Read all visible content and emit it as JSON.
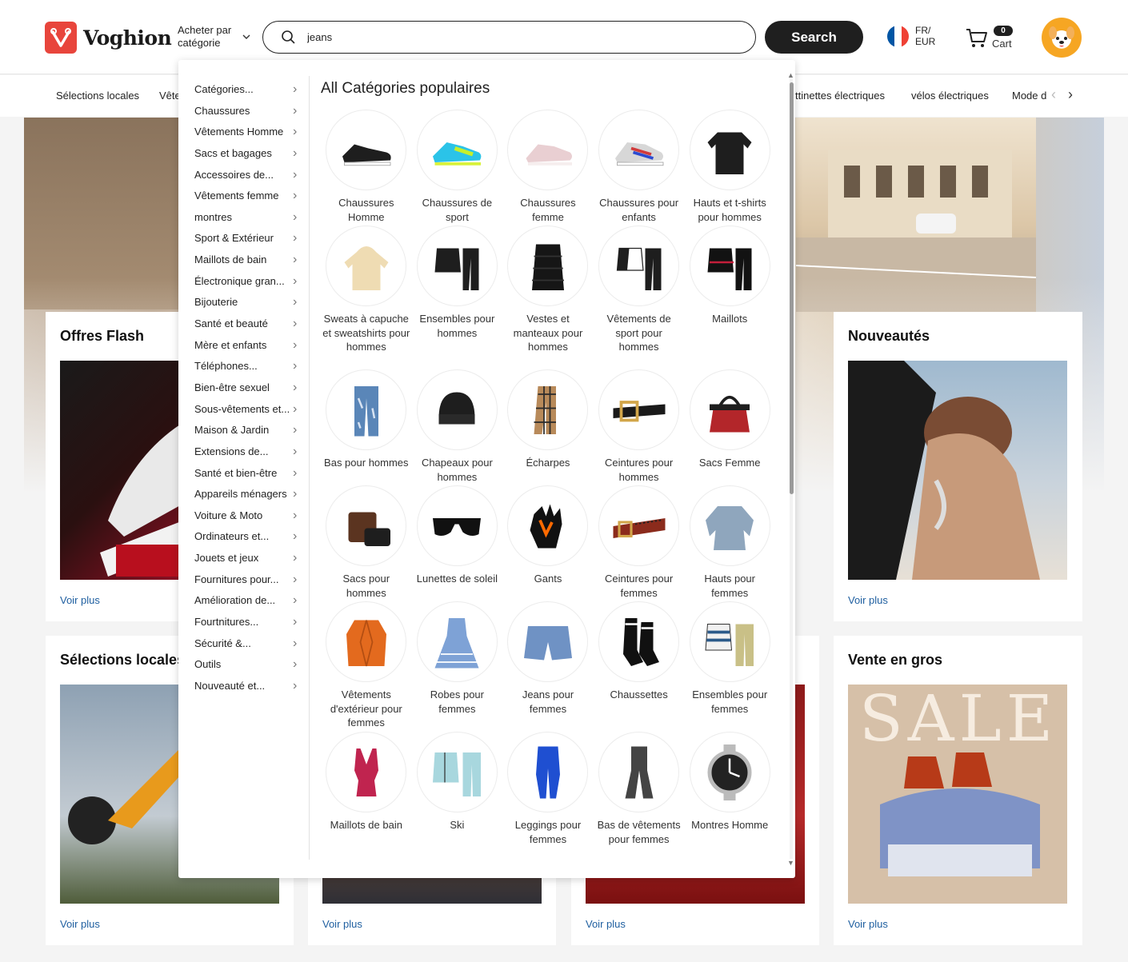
{
  "header": {
    "logo_text": "Voghion",
    "category_button": "Acheter par catégorie",
    "search": {
      "value": "jeans",
      "button": "Search"
    },
    "locale": {
      "lang": "FR/",
      "currency": "EUR",
      "flag_colors": [
        "#0055a4",
        "#ffffff",
        "#ef4135"
      ]
    },
    "cart": {
      "count": "0",
      "label": "Cart"
    },
    "accent_color": "#e8453c"
  },
  "subnav": {
    "left_items": [
      "Sélections locales",
      "Vête"
    ],
    "right_items": [
      "ttinettes électriques",
      "vélos électriques",
      "Mode d"
    ]
  },
  "cards": {
    "offres_flash": {
      "title": "Offres Flash",
      "more": "Voir plus"
    },
    "nouveautes": {
      "title": "Nouveautés",
      "more": "Voir plus"
    },
    "selections_locales": {
      "title": "Sélections locales",
      "more": "Voir plus"
    },
    "col2": {
      "more": "Voir plus"
    },
    "col3": {
      "more": "Voir plus"
    },
    "vente_en_gros": {
      "title": "Vente en gros",
      "more": "Voir plus",
      "image_text": "SALE"
    }
  },
  "dropdown": {
    "categories": [
      "Catégories...",
      "Chaussures",
      "Vêtements Homme",
      "Sacs et bagages",
      "Accessoires de...",
      "Vêtements femme",
      "montres",
      "Sport & Extérieur",
      "Maillots de bain",
      "Électronique gran...",
      "Bijouterie",
      "Santé et beauté",
      "Mère et enfants",
      "Téléphones...",
      "Bien-être sexuel",
      "Sous-vêtements et...",
      "Maison & Jardin",
      "Extensions de...",
      "Santé et bien-être",
      "Appareils ménagers",
      "Voiture & Moto",
      "Ordinateurs et...",
      "Jouets et jeux",
      "Fournitures pour...",
      "Amélioration de...",
      "Fourtnitures...",
      "Sécurité &...",
      "Outils",
      "Nouveauté et..."
    ],
    "popular_title": "All Catégories populaires",
    "popular": [
      {
        "label": "Chaussures Homme",
        "icon": "mens-shoe-icon"
      },
      {
        "label": "Chaussures de sport",
        "icon": "sport-shoe-icon"
      },
      {
        "label": "Chaussures femme",
        "icon": "womens-shoe-icon"
      },
      {
        "label": "Chaussures pour enfants",
        "icon": "kids-shoe-icon"
      },
      {
        "label": "Hauts et t-shirts pour hommes",
        "icon": "mens-shirt-icon"
      },
      {
        "label": "Sweats à capuche et sweatshirts pour hommes",
        "icon": "hoodie-icon"
      },
      {
        "label": "Ensembles pour hommes",
        "icon": "mens-set-icon"
      },
      {
        "label": "Vestes et manteaux pour hommes",
        "icon": "vest-icon"
      },
      {
        "label": "Vêtements de sport pour hommes",
        "icon": "tracksuit-icon"
      },
      {
        "label": "Maillots",
        "icon": "jersey-icon"
      },
      {
        "label": "Bas pour hommes",
        "icon": "jeans-icon"
      },
      {
        "label": "Chapeaux pour hommes",
        "icon": "beanie-icon"
      },
      {
        "label": "Écharpes",
        "icon": "scarf-icon"
      },
      {
        "label": "Ceintures pour hommes",
        "icon": "belt-icon"
      },
      {
        "label": "Sacs Femme",
        "icon": "handbag-icon"
      },
      {
        "label": "Sacs pour hommes",
        "icon": "mens-bag-icon"
      },
      {
        "label": "Lunettes de soleil",
        "icon": "sunglasses-icon"
      },
      {
        "label": "Gants",
        "icon": "gloves-icon"
      },
      {
        "label": "Ceintures pour femmes",
        "icon": "womens-belt-icon"
      },
      {
        "label": "Hauts pour femmes",
        "icon": "womens-top-icon"
      },
      {
        "label": "Vêtements d'extérieur pour femmes",
        "icon": "blazer-icon"
      },
      {
        "label": "Robes pour femmes",
        "icon": "dress-icon"
      },
      {
        "label": "Jeans pour femmes",
        "icon": "denim-shorts-icon"
      },
      {
        "label": "Chaussettes",
        "icon": "socks-icon"
      },
      {
        "label": "Ensembles pour femmes",
        "icon": "womens-set-icon"
      },
      {
        "label": "Maillots de bain",
        "icon": "swimsuit-icon"
      },
      {
        "label": "Ski",
        "icon": "ski-suit-icon"
      },
      {
        "label": "Leggings pour femmes",
        "icon": "leggings-icon"
      },
      {
        "label": "Bas de vêtements pour femmes",
        "icon": "flare-pants-icon"
      },
      {
        "label": "Montres Homme",
        "icon": "watch-icon"
      }
    ]
  }
}
